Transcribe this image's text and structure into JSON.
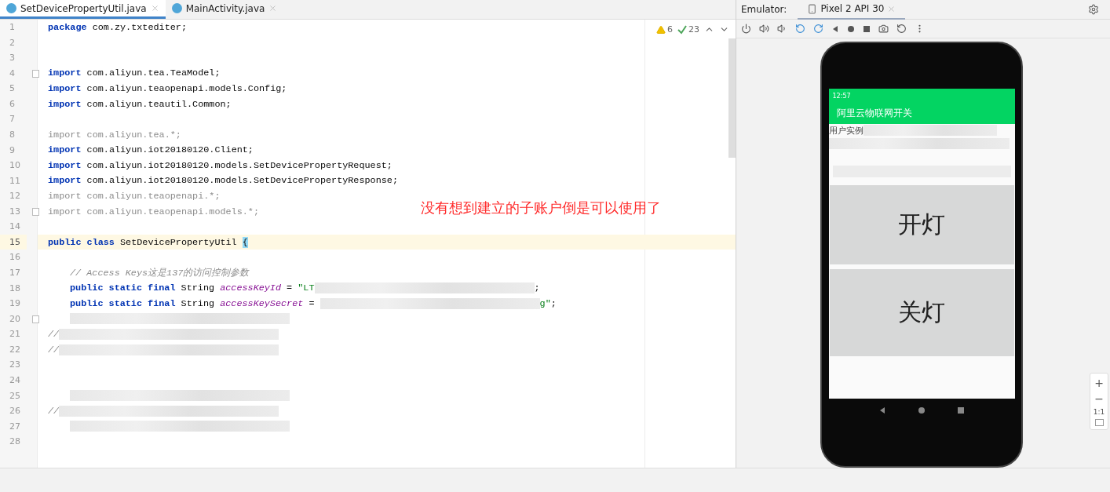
{
  "editor_tabs": [
    {
      "label": "SetDevicePropertyUtil.java",
      "selected": true
    },
    {
      "label": "MainActivity.java",
      "selected": false
    }
  ],
  "inspections": {
    "warnings": "6",
    "weak_warnings": "23"
  },
  "code_lines": [
    {
      "number": "1",
      "current": false,
      "fold": false,
      "tokens": [
        {
          "kind": "keyword",
          "text": "package"
        },
        {
          "kind": "plain",
          "text": " com.zy.txtediter;"
        }
      ]
    },
    {
      "number": "2",
      "current": false,
      "fold": false
    },
    {
      "number": "3",
      "current": false,
      "fold": false
    },
    {
      "number": "4",
      "current": false,
      "fold": true,
      "tokens": [
        {
          "kind": "keyword",
          "text": "import"
        },
        {
          "kind": "plain",
          "text": " com.aliyun.tea.TeaModel;"
        }
      ]
    },
    {
      "number": "5",
      "current": false,
      "fold": false,
      "tokens": [
        {
          "kind": "keyword",
          "text": "import"
        },
        {
          "kind": "plain",
          "text": " com.aliyun.teaopenapi.models.Config;"
        }
      ]
    },
    {
      "number": "6",
      "current": false,
      "fold": false,
      "tokens": [
        {
          "kind": "keyword",
          "text": "import"
        },
        {
          "kind": "plain",
          "text": " com.aliyun.teautil.Common;"
        }
      ]
    },
    {
      "number": "7",
      "current": false,
      "fold": false
    },
    {
      "number": "8",
      "current": false,
      "fold": false,
      "tokens": [
        {
          "kind": "unused",
          "text": "import com.aliyun.tea.*;"
        }
      ]
    },
    {
      "number": "9",
      "current": false,
      "fold": false,
      "tokens": [
        {
          "kind": "keyword",
          "text": "import"
        },
        {
          "kind": "plain",
          "text": " com.aliyun.iot20180120.Client;"
        }
      ]
    },
    {
      "number": "10",
      "current": false,
      "fold": false,
      "tokens": [
        {
          "kind": "keyword",
          "text": "import"
        },
        {
          "kind": "plain",
          "text": " com.aliyun.iot20180120.models.SetDevicePropertyRequest;"
        }
      ]
    },
    {
      "number": "11",
      "current": false,
      "fold": false,
      "tokens": [
        {
          "kind": "keyword",
          "text": "import"
        },
        {
          "kind": "plain",
          "text": " com.aliyun.iot20180120.models.SetDevicePropertyResponse;"
        }
      ]
    },
    {
      "number": "12",
      "current": false,
      "fold": false,
      "tokens": [
        {
          "kind": "unused",
          "text": "import com.aliyun.teaopenapi.*;"
        }
      ]
    },
    {
      "number": "13",
      "current": false,
      "fold": true,
      "tokens": [
        {
          "kind": "unused",
          "text": "import com.aliyun.teaopenapi.models.*;"
        }
      ]
    },
    {
      "number": "14",
      "current": false,
      "fold": false
    },
    {
      "number": "15",
      "current": true,
      "fold": false,
      "tokens": [
        {
          "kind": "keyword",
          "text": "public class"
        },
        {
          "kind": "plain",
          "text": " SetDevicePropertyUtil "
        },
        {
          "kind": "brace",
          "text": "{"
        }
      ]
    },
    {
      "number": "16",
      "current": false,
      "fold": false
    },
    {
      "number": "17",
      "current": false,
      "fold": false,
      "tokens": [
        {
          "kind": "indent"
        },
        {
          "kind": "comment",
          "text": "// Access Keys这是137的访问控制参数"
        }
      ]
    },
    {
      "number": "18",
      "current": false,
      "fold": false,
      "tokens": [
        {
          "kind": "indent"
        },
        {
          "kind": "keyword",
          "text": "public static final"
        },
        {
          "kind": "plain",
          "text": " String "
        },
        {
          "kind": "field",
          "text": "accessKeyId"
        },
        {
          "kind": "plain",
          "text": " = "
        },
        {
          "kind": "string",
          "text": "\"LT"
        },
        {
          "kind": "blur"
        },
        {
          "kind": "plain",
          "text": ";"
        }
      ]
    },
    {
      "number": "19",
      "current": false,
      "fold": false,
      "tokens": [
        {
          "kind": "indent"
        },
        {
          "kind": "keyword",
          "text": "public static final"
        },
        {
          "kind": "plain",
          "text": " String "
        },
        {
          "kind": "field",
          "text": "accessKeySecret"
        },
        {
          "kind": "plain",
          "text": " = "
        },
        {
          "kind": "blur"
        },
        {
          "kind": "string",
          "text": "g\""
        },
        {
          "kind": "plain",
          "text": ";"
        }
      ]
    },
    {
      "number": "20",
      "current": false,
      "fold": true,
      "tokens": [
        {
          "kind": "indent"
        },
        {
          "kind": "blur"
        }
      ]
    },
    {
      "number": "21",
      "current": false,
      "fold": false,
      "tokens": [
        {
          "kind": "comment",
          "text": "//"
        },
        {
          "kind": "blur"
        }
      ]
    },
    {
      "number": "22",
      "current": false,
      "fold": false,
      "tokens": [
        {
          "kind": "comment",
          "text": "//"
        },
        {
          "kind": "blur"
        }
      ]
    },
    {
      "number": "23",
      "current": false,
      "fold": false
    },
    {
      "number": "24",
      "current": false,
      "fold": false
    },
    {
      "number": "25",
      "current": false,
      "fold": false,
      "tokens": [
        {
          "kind": "indent"
        },
        {
          "kind": "blur"
        }
      ]
    },
    {
      "number": "26",
      "current": false,
      "fold": false,
      "tokens": [
        {
          "kind": "comment",
          "text": "//"
        },
        {
          "kind": "blur"
        }
      ]
    },
    {
      "number": "27",
      "current": false,
      "fold": false,
      "tokens": [
        {
          "kind": "indent"
        },
        {
          "kind": "blur"
        }
      ]
    },
    {
      "number": "28",
      "current": false,
      "fold": false
    }
  ],
  "annotation": "没有想到建立的子账户倒是可以使用了",
  "emulator": {
    "label": "Emulator:",
    "device_tab": {
      "label": "Pixel 2 API 30",
      "selected": true
    },
    "phone": {
      "time": "12:57",
      "app_title": "阿里云物联网开关",
      "info_text": "用户实例",
      "buttons": [
        "开灯",
        "关灯"
      ]
    },
    "zoom_controls": [
      "+",
      "−",
      "1:1"
    ]
  }
}
